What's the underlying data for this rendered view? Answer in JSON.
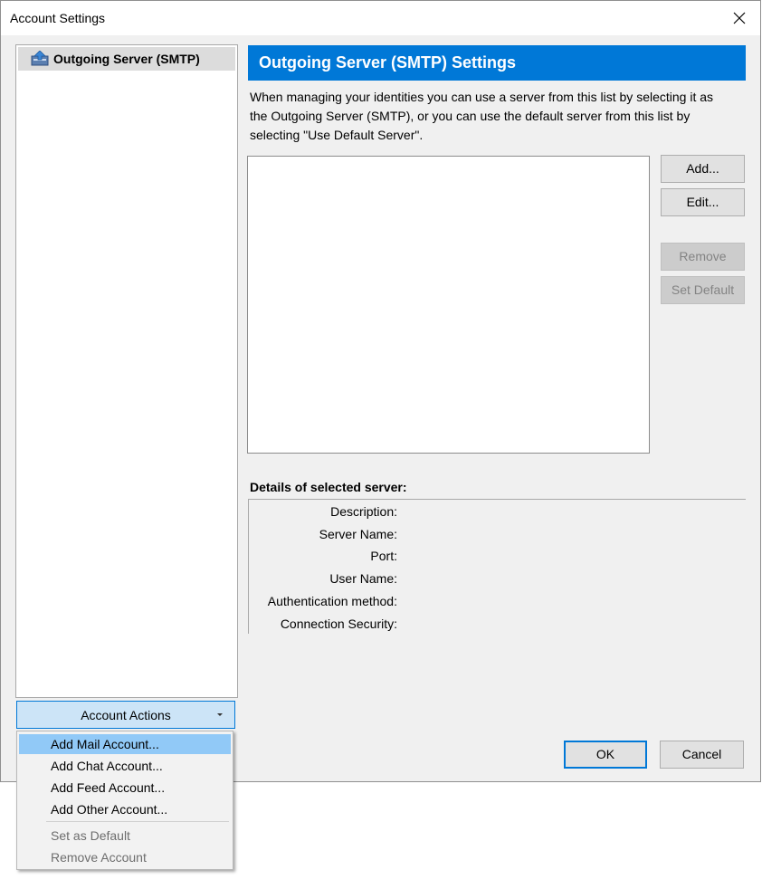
{
  "window": {
    "title": "Account Settings"
  },
  "tree": {
    "items": [
      {
        "label": "Outgoing Server (SMTP)"
      }
    ]
  },
  "account_actions": {
    "label": "Account Actions"
  },
  "pane": {
    "header": "Outgoing Server (SMTP) Settings",
    "description": [
      "When managing your identities you can use a server from this list by selecting it as",
      "the Outgoing Server (SMTP), or you can use the default server from this list by",
      "selecting \"Use Default Server\"."
    ],
    "buttons": {
      "add": "Add...",
      "edit": "Edit...",
      "remove": "Remove",
      "set_default": "Set Default"
    }
  },
  "details": {
    "title": "Details of selected server:",
    "fields": [
      "Description:",
      "Server Name:",
      "Port:",
      "User Name:",
      "Authentication method:",
      "Connection Security:"
    ]
  },
  "footer": {
    "ok": "OK",
    "cancel": "Cancel"
  },
  "menu": {
    "items": [
      {
        "label": "Add Mail Account...",
        "state": "highlighted"
      },
      {
        "label": "Add Chat Account...",
        "state": "enabled"
      },
      {
        "label": "Add Feed Account...",
        "state": "enabled"
      },
      {
        "label": "Add Other Account...",
        "state": "enabled"
      },
      {
        "label": "Set as Default",
        "state": "disabled"
      },
      {
        "label": "Remove Account",
        "state": "disabled"
      }
    ]
  },
  "colors": {
    "accent": "#0078d7",
    "highlight": "#91c9f7",
    "selected_item": "#dcdcdc"
  }
}
